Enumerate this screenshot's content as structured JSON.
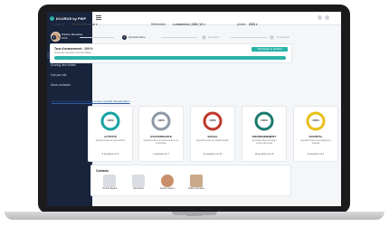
{
  "app": {
    "name": "ECORUS by PWP",
    "brand_color": "#2bb3a8",
    "sidebar_color": "#18233c"
  },
  "user": {
    "name": "Pauline Menadue",
    "role": "PWP"
  },
  "sidebar": {
    "items": [
      {
        "label": "Tableau de bord"
      },
      {
        "label": "Scoring des entités"
      },
      {
        "label": "Vue par site"
      },
      {
        "label": "Nous contacter"
      }
    ]
  },
  "topbar": {
    "icons": [
      "menu-icon",
      "bell-icon",
      "user-icon"
    ]
  },
  "breadcrumb": {
    "back_label": "< Retour"
  },
  "filters": {
    "entity_label": "Entreprise :",
    "entity_value": "Pauline Menadue ▾",
    "ref_label": "Référentiel :",
    "ref_value": "e-commerce_0464_V2 ▾",
    "year_label": "Année :",
    "year_value": "2023 ▾"
  },
  "stepper": {
    "steps": [
      {
        "n": "1",
        "label": "Inscription",
        "active": true
      },
      {
        "n": "2",
        "label": "Questionnaire",
        "active": true
      },
      {
        "n": "3",
        "label": "Résultats",
        "active": false
      },
      {
        "n": "4",
        "label": "Finalisation",
        "active": false
      }
    ]
  },
  "progress": {
    "title": "Taux d'avancement : 100 %",
    "subtitle": "Toutes les questions ont été traitées",
    "button": "Télécharger le certificat",
    "value_fraction": 1.0
  },
  "hint": "Accéder à l'ensemble des résultats et aux conseils d'amélioration",
  "kpis": [
    {
      "label": "100%",
      "title": "ACTIVITÉ",
      "desc": "Questions liées à votre activité",
      "foot": "5 questions sur 5",
      "color": "#1aa3a3",
      "value": 1.0
    },
    {
      "label": "100%",
      "title": "GOUVERNANCE",
      "desc": "Questions liées à la gouvernance de l'entreprise",
      "foot": "7 questions sur 7",
      "color": "#8f9aa6",
      "value": 1.0
    },
    {
      "label": "100%",
      "title": "SOCIAL",
      "desc": "Questions liées au capital humain",
      "foot": "21 questions sur 21",
      "color": "#c0392b",
      "value": 1.0
    },
    {
      "label": "100%",
      "title": "ENVIRONNEMENT",
      "desc": "Questions liées à l'impact environnemental",
      "foot": "16 questions sur 16",
      "color": "#1a7a6e",
      "value": 1.0
    },
    {
      "label": "100%",
      "title": "SOCIÉTAL",
      "desc": "Questions liées à l'engagement sociétal",
      "foot": "6 questions sur 6",
      "color": "#e8c01a",
      "value": 1.0
    }
  ],
  "contacts": {
    "title": "Contacts",
    "people": [
      {
        "name": "Thomas Bayard",
        "photo": "generic"
      },
      {
        "name": "Clara Morel",
        "photo": "generic"
      },
      {
        "name": "Sophie Lefebvre",
        "photo": "round"
      },
      {
        "name": "Pauline Menadue",
        "photo": "person"
      }
    ]
  },
  "device": {
    "brand_label": "MacBook Air"
  }
}
